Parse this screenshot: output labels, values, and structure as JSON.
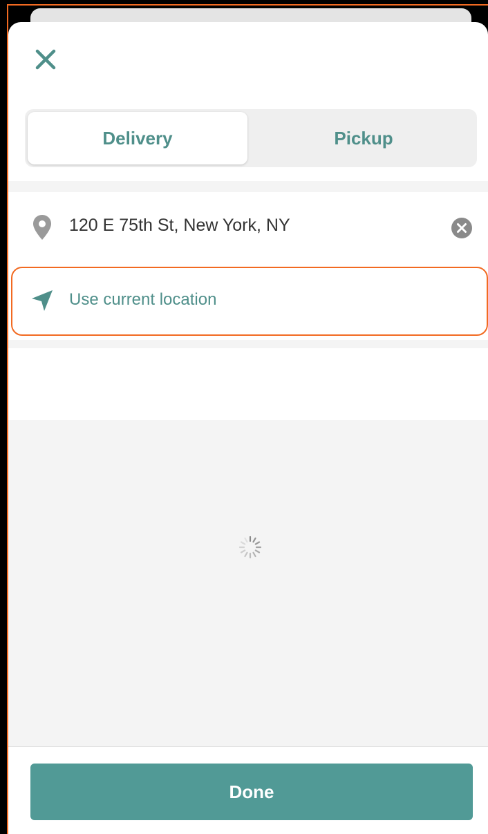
{
  "header": {
    "close_icon": "close-icon"
  },
  "tabs": [
    {
      "label": "Delivery",
      "selected": true
    },
    {
      "label": "Pickup",
      "selected": false
    }
  ],
  "address": {
    "value": "120 E 75th St, New York, NY",
    "icon": "location-pin-icon",
    "clear_icon": "clear-circle-icon"
  },
  "current_location": {
    "label": "Use current location",
    "icon": "navigation-arrow-icon"
  },
  "footer": {
    "done_label": "Done"
  },
  "colors": {
    "accent": "#519a96",
    "accent_text": "#4f8f8a",
    "highlight": "#f26a21",
    "background_gray": "#f4f4f4"
  }
}
